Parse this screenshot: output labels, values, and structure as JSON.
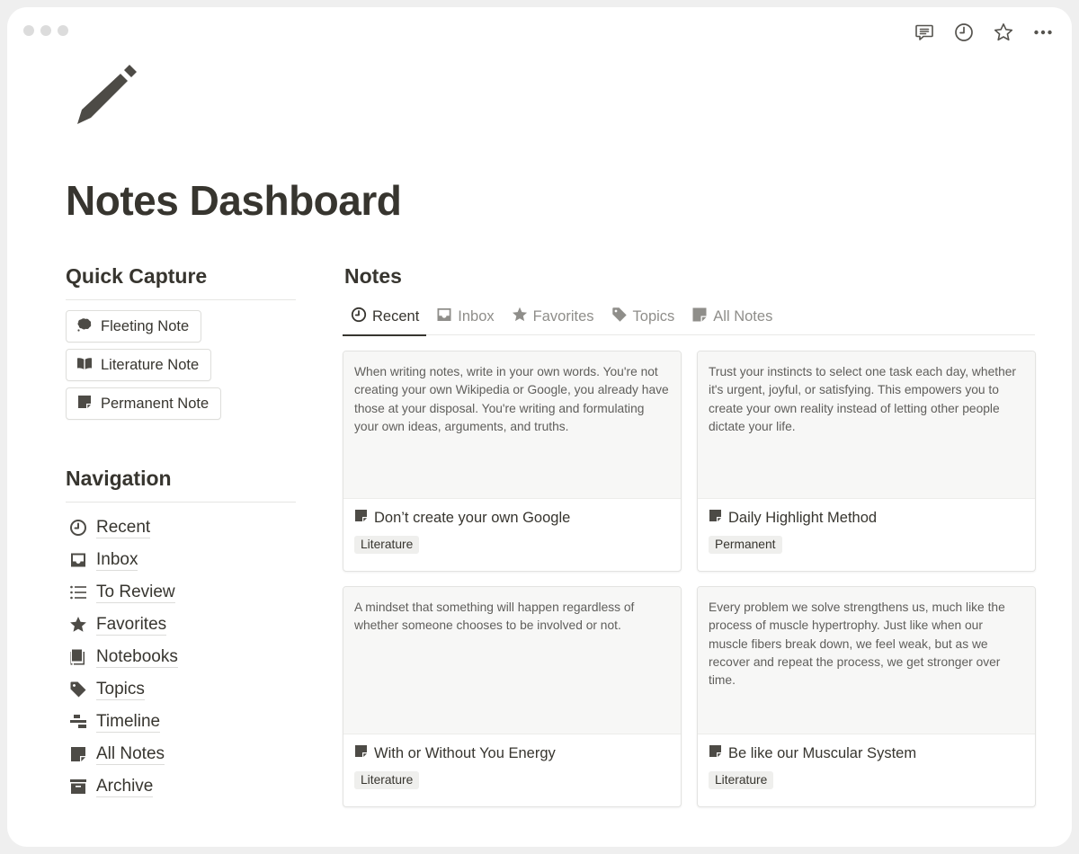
{
  "window": {
    "traffic_lights": [
      "close",
      "minimize",
      "zoom"
    ],
    "topbar_icons": [
      {
        "name": "comments-icon",
        "label": "Comments"
      },
      {
        "name": "history-icon",
        "label": "Updates"
      },
      {
        "name": "favorite-star-icon",
        "label": "Favorite"
      },
      {
        "name": "more-options-icon",
        "label": "More"
      }
    ]
  },
  "page": {
    "icon": "pencil-icon",
    "title": "Notes Dashboard"
  },
  "quick_capture": {
    "heading": "Quick Capture",
    "buttons": [
      {
        "label": "Fleeting Note",
        "icon": "cloud-icon"
      },
      {
        "label": "Literature Note",
        "icon": "open-book-icon"
      },
      {
        "label": "Permanent Note",
        "icon": "note-icon"
      }
    ]
  },
  "navigation": {
    "heading": "Navigation",
    "items": [
      {
        "label": "Recent",
        "icon": "clock-icon"
      },
      {
        "label": "Inbox",
        "icon": "inbox-icon"
      },
      {
        "label": "To Review",
        "icon": "list-icon"
      },
      {
        "label": "Favorites",
        "icon": "star-icon"
      },
      {
        "label": "Notebooks",
        "icon": "notebooks-icon"
      },
      {
        "label": "Topics",
        "icon": "tag-icon"
      },
      {
        "label": "Timeline",
        "icon": "timeline-icon"
      },
      {
        "label": "All Notes",
        "icon": "note-icon"
      },
      {
        "label": "Archive",
        "icon": "archive-icon"
      }
    ]
  },
  "notes": {
    "heading": "Notes",
    "active_tab": "Recent",
    "tabs": [
      {
        "label": "Recent",
        "icon": "clock-icon"
      },
      {
        "label": "Inbox",
        "icon": "inbox-icon"
      },
      {
        "label": "Favorites",
        "icon": "star-icon"
      },
      {
        "label": "Topics",
        "icon": "tag-icon"
      },
      {
        "label": "All Notes",
        "icon": "note-icon"
      }
    ],
    "cards": [
      {
        "preview": "When writing notes, write in your own words. You're not creating your own Wikipedia or Google, you already have those at your disposal. You're writing and formulating your own ideas, arguments, and truths.",
        "title": "Don’t create your own Google",
        "tag": "Literature"
      },
      {
        "preview": "Trust your instincts to select one task each day, whether it's urgent, joyful, or satisfying. This empowers you to create your own reality instead of letting other people dictate your life.",
        "title": "Daily Highlight Method",
        "tag": "Permanent"
      },
      {
        "preview": "A mindset that something will happen regardless of whether someone chooses to be involved or not.",
        "title": "With or Without You Energy",
        "tag": "Literature"
      },
      {
        "preview": "Every problem we solve strengthens us, much like the process of muscle hypertrophy. Just like when our muscle fibers break down, we feel weak, but as we recover and repeat the process, we get stronger over time.",
        "title": "Be like our Muscular System",
        "tag": "Literature"
      }
    ]
  },
  "colors": {
    "text": "#37352f",
    "muted": "#8f8e8a",
    "icon": "#55534e",
    "card_preview_bg": "#f7f7f6",
    "tag_bg": "#efefed"
  }
}
